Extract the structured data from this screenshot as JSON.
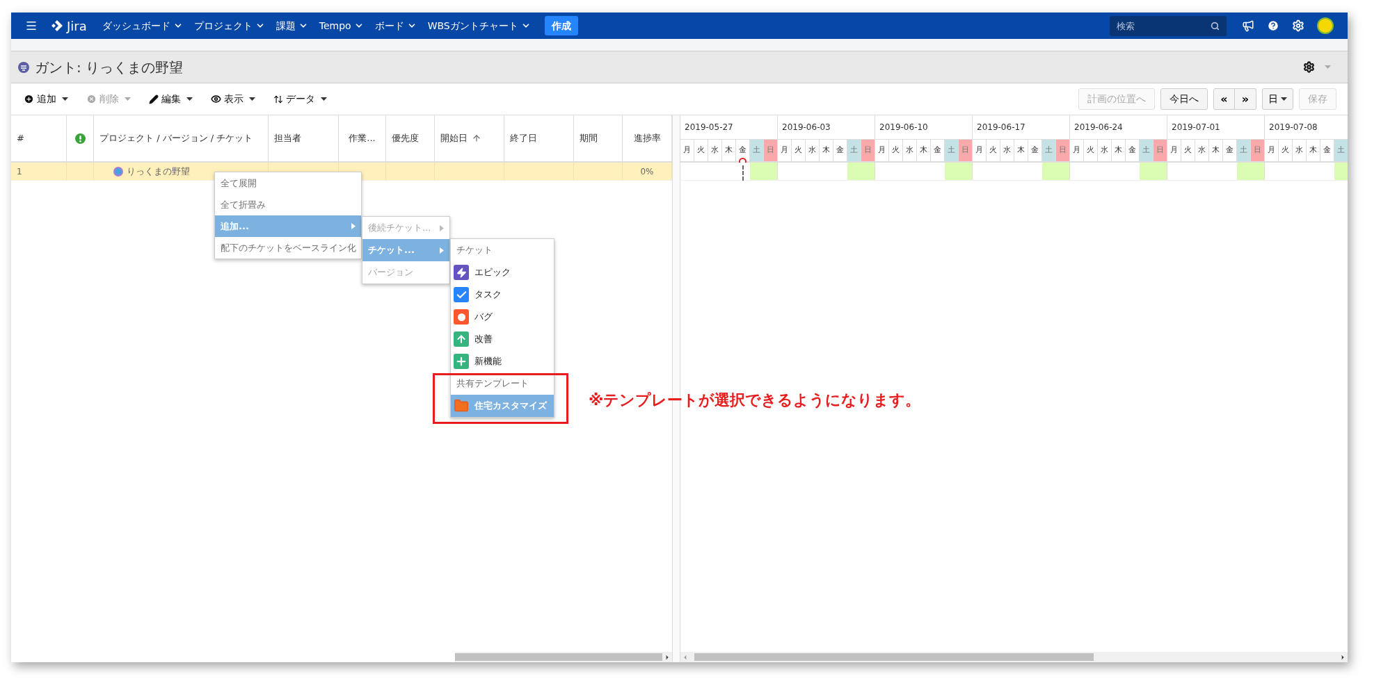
{
  "nav": {
    "logo": "Jira",
    "items": [
      {
        "label": "ダッシュボード"
      },
      {
        "label": "プロジェクト"
      },
      {
        "label": "課題"
      },
      {
        "label": "Tempo"
      },
      {
        "label": "ボード"
      },
      {
        "label": "WBSガントチャート"
      }
    ],
    "create_button": "作成",
    "search": {
      "placeholder": "検索"
    }
  },
  "page_title": "ガント: りっくまの野望",
  "toolbar": {
    "left_buttons": [
      {
        "kind": "add",
        "label": "追加",
        "disabled": false
      },
      {
        "kind": "delete",
        "label": "削除",
        "disabled": true
      },
      {
        "kind": "edit",
        "label": "編集",
        "disabled": false
      },
      {
        "kind": "view",
        "label": "表示",
        "disabled": false
      },
      {
        "kind": "data",
        "label": "データ",
        "disabled": false
      }
    ],
    "right_buttons": [
      {
        "label": "計画の位置へ",
        "disabled": true
      },
      {
        "label": "今日へ",
        "disabled": false
      }
    ],
    "prev_button": "«",
    "next_button": "»",
    "scale_dropdown": "日",
    "save_button": {
      "label": "保存",
      "disabled": true
    }
  },
  "table": {
    "columns": [
      {
        "kind": "text",
        "label": "#",
        "sorted": false
      },
      {
        "kind": "icon",
        "sorted": false
      },
      {
        "kind": "text",
        "label": "プロジェクト / バージョン / チケット",
        "sorted": false
      },
      {
        "kind": "text",
        "label": "担当者",
        "sorted": false
      },
      {
        "kind": "text",
        "label": "作業...",
        "sorted": false
      },
      {
        "kind": "text",
        "label": "優先度",
        "sorted": false
      },
      {
        "kind": "text",
        "label": "開始日",
        "sorted": true
      },
      {
        "kind": "text",
        "label": "終了日",
        "sorted": false
      },
      {
        "kind": "text",
        "label": "期間",
        "sorted": false
      },
      {
        "kind": "text",
        "label": "進捗率",
        "sorted": false
      }
    ],
    "rows": [
      {
        "number": "1",
        "name": "りっくまの野望",
        "progress": "0%",
        "selected": true
      }
    ]
  },
  "gantt": {
    "weeks": [
      {
        "start": "2019-05-27",
        "days": [
          {
            "label": "月",
            "kind": "weekday",
            "today": false
          },
          {
            "label": "火",
            "kind": "weekday",
            "today": false
          },
          {
            "label": "水",
            "kind": "weekday",
            "today": false
          },
          {
            "label": "木",
            "kind": "weekday",
            "today": false
          },
          {
            "label": "金",
            "kind": "weekday",
            "today": true
          },
          {
            "label": "土",
            "kind": "saturday",
            "today": false
          },
          {
            "label": "日",
            "kind": "sunday",
            "today": false
          }
        ]
      },
      {
        "start": "2019-06-03",
        "days": [
          {
            "label": "月",
            "kind": "weekday",
            "today": false
          },
          {
            "label": "火",
            "kind": "weekday",
            "today": false
          },
          {
            "label": "水",
            "kind": "weekday",
            "today": false
          },
          {
            "label": "木",
            "kind": "weekday",
            "today": false
          },
          {
            "label": "金",
            "kind": "weekday",
            "today": false
          },
          {
            "label": "土",
            "kind": "saturday",
            "today": false
          },
          {
            "label": "日",
            "kind": "sunday",
            "today": false
          }
        ]
      },
      {
        "start": "2019-06-10",
        "days": [
          {
            "label": "月",
            "kind": "weekday",
            "today": false
          },
          {
            "label": "火",
            "kind": "weekday",
            "today": false
          },
          {
            "label": "水",
            "kind": "weekday",
            "today": false
          },
          {
            "label": "木",
            "kind": "weekday",
            "today": false
          },
          {
            "label": "金",
            "kind": "weekday",
            "today": false
          },
          {
            "label": "土",
            "kind": "saturday",
            "today": false
          },
          {
            "label": "日",
            "kind": "sunday",
            "today": false
          }
        ]
      },
      {
        "start": "2019-06-17",
        "days": [
          {
            "label": "月",
            "kind": "weekday",
            "today": false
          },
          {
            "label": "火",
            "kind": "weekday",
            "today": false
          },
          {
            "label": "水",
            "kind": "weekday",
            "today": false
          },
          {
            "label": "木",
            "kind": "weekday",
            "today": false
          },
          {
            "label": "金",
            "kind": "weekday",
            "today": false
          },
          {
            "label": "土",
            "kind": "saturday",
            "today": false
          },
          {
            "label": "日",
            "kind": "sunday",
            "today": false
          }
        ]
      },
      {
        "start": "2019-06-24",
        "days": [
          {
            "label": "月",
            "kind": "weekday",
            "today": false
          },
          {
            "label": "火",
            "kind": "weekday",
            "today": false
          },
          {
            "label": "水",
            "kind": "weekday",
            "today": false
          },
          {
            "label": "木",
            "kind": "weekday",
            "today": false
          },
          {
            "label": "金",
            "kind": "weekday",
            "today": false
          },
          {
            "label": "土",
            "kind": "saturday",
            "today": false
          },
          {
            "label": "日",
            "kind": "sunday",
            "today": false
          }
        ]
      },
      {
        "start": "2019-07-01",
        "days": [
          {
            "label": "月",
            "kind": "weekday",
            "today": false
          },
          {
            "label": "火",
            "kind": "weekday",
            "today": false
          },
          {
            "label": "水",
            "kind": "weekday",
            "today": false
          },
          {
            "label": "木",
            "kind": "weekday",
            "today": false
          },
          {
            "label": "金",
            "kind": "weekday",
            "today": false
          },
          {
            "label": "土",
            "kind": "saturday",
            "today": false
          },
          {
            "label": "日",
            "kind": "sunday",
            "today": false
          }
        ]
      },
      {
        "start": "2019-07-08",
        "days": [
          {
            "label": "月",
            "kind": "weekday",
            "today": false
          },
          {
            "label": "火",
            "kind": "weekday",
            "today": false
          },
          {
            "label": "水",
            "kind": "weekday",
            "today": false
          },
          {
            "label": "木",
            "kind": "weekday",
            "today": false
          },
          {
            "label": "金",
            "kind": "weekday",
            "today": false
          },
          {
            "label": "土",
            "kind": "saturday",
            "today": false
          }
        ]
      }
    ]
  },
  "context_menu": {
    "items": [
      {
        "label": "全て展開",
        "selected": false,
        "submenu": false
      },
      {
        "label": "全て折畳み",
        "selected": false,
        "submenu": false
      },
      {
        "label": "追加...",
        "selected": true,
        "submenu": true
      },
      {
        "label": "配下のチケットをベースライン化",
        "selected": false,
        "submenu": false
      }
    ]
  },
  "add_submenu": {
    "items": [
      {
        "label": "後続チケット...",
        "selected": false,
        "submenu": true,
        "disabled": true
      },
      {
        "label": "チケット...",
        "selected": true,
        "submenu": true,
        "disabled": false
      },
      {
        "label": "バージョン",
        "selected": false,
        "submenu": false,
        "disabled": true
      }
    ]
  },
  "ticket_submenu": {
    "items": [
      {
        "kind": "header",
        "label": "チケット"
      },
      {
        "kind": "epic",
        "label": "エピック",
        "selected": false
      },
      {
        "kind": "task",
        "label": "タスク",
        "selected": false
      },
      {
        "kind": "bug",
        "label": "バグ",
        "selected": false
      },
      {
        "kind": "improvement",
        "label": "改善",
        "selected": false
      },
      {
        "kind": "new_feature",
        "label": "新機能",
        "selected": false
      },
      {
        "kind": "header",
        "label": "共有テンプレート"
      },
      {
        "kind": "template",
        "label": "住宅カスタマイズ",
        "selected": true
      }
    ]
  },
  "annotation": {
    "text": "※テンプレートが選択できるようになります。"
  }
}
